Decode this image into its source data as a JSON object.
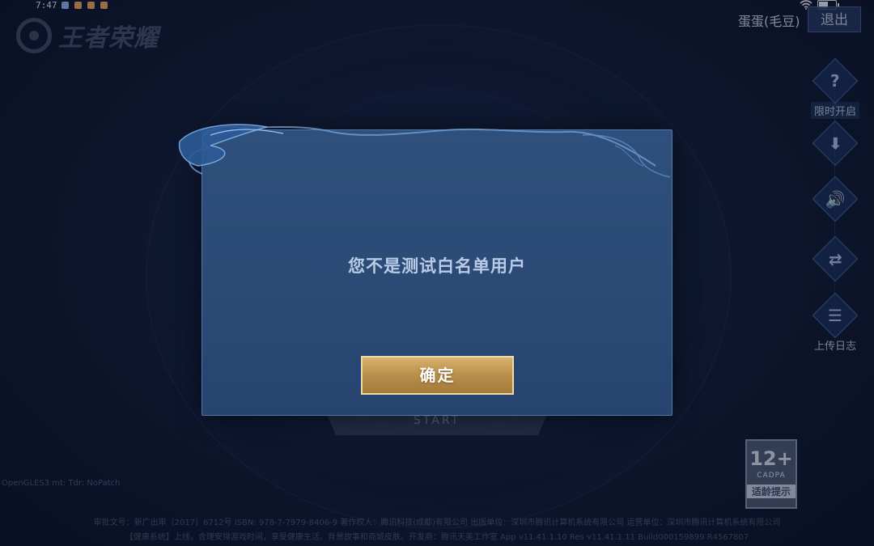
{
  "status_bar": {
    "time": "7:47",
    "notification_colors": [
      "#8fb3e8",
      "#e8a25a",
      "#e8a25a",
      "#e8a25a"
    ],
    "battery_level": 0.55,
    "icons": [
      "wifi-icon",
      "battery-icon"
    ]
  },
  "logo": {
    "text": "王者荣耀",
    "icon": "game-logo-icon"
  },
  "account": {
    "name": "蛋蛋(毛豆)",
    "logout_label": "退出"
  },
  "side_tools": [
    {
      "icon": "?",
      "icon_name": "question-icon",
      "label": "限时开启"
    },
    {
      "icon": "⬇",
      "icon_name": "download-icon",
      "label": ""
    },
    {
      "icon": "🔊",
      "icon_name": "volume-icon",
      "label": ""
    },
    {
      "icon": "⇄",
      "icon_name": "switch-account-icon",
      "label": ""
    },
    {
      "icon": "☰",
      "icon_name": "log-file-icon",
      "label": "上传日志"
    }
  ],
  "dialog": {
    "message": "您不是测试白名单用户",
    "confirm_label": "确定"
  },
  "start_button": {
    "label": "START"
  },
  "age_rating": {
    "number": "12+",
    "org": "CADPA",
    "tip": "适龄提示"
  },
  "colors": {
    "dialog_bg": "#2d4c79",
    "dialog_border": "#4f77a8",
    "confirm_gold": "#c29a55",
    "message_text": "#b9cbe6"
  }
}
